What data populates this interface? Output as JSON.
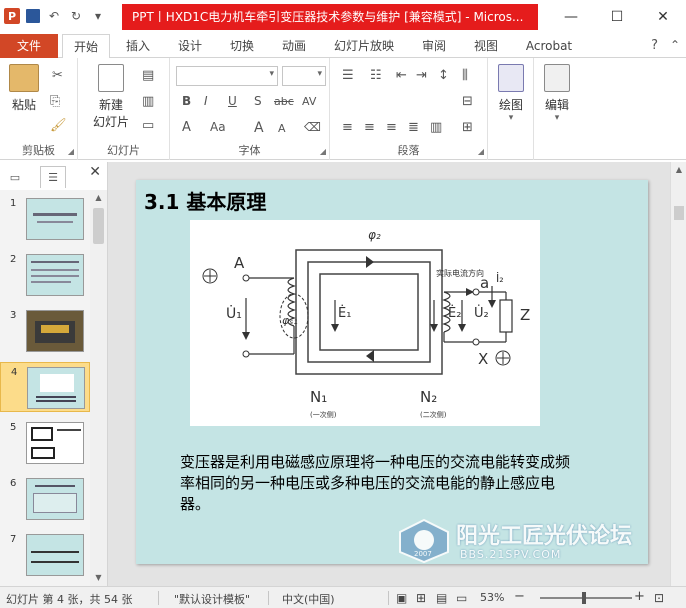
{
  "titlebar": {
    "app_glyph": "P",
    "title": "PPT丨HXD1C电力机车牵引变压器技术参数与维护 [兼容模式] - Micros...",
    "qat_undo": "↶",
    "qat_redo": "↻",
    "minimize": "—",
    "restore": "☐",
    "close": "✕"
  },
  "ribbon_tabs": {
    "file": "文件",
    "tabs": [
      "开始",
      "插入",
      "设计",
      "切换",
      "动画",
      "幻灯片放映",
      "审阅",
      "视图",
      "Acrobat"
    ],
    "help": "?",
    "collapse": "⌃"
  },
  "ribbon": {
    "clipboard": {
      "paste": "粘贴",
      "label": "剪贴板"
    },
    "slides": {
      "new_slide_line1": "新建",
      "new_slide_line2": "幻灯片",
      "label": "幻灯片"
    },
    "font": {
      "label": "字体",
      "bold": "B",
      "italic": "I",
      "underline": "U",
      "shadow": "S",
      "strike": "abc",
      "spacing": "AV",
      "grow": "A",
      "shrink": "A",
      "clear": "A"
    },
    "paragraph": {
      "label": "段落"
    },
    "drawing": {
      "label": "绘图"
    },
    "editing": {
      "label": "编辑"
    }
  },
  "slide_panel": {
    "close": "✕",
    "thumbnails": [
      {
        "num": "1"
      },
      {
        "num": "2"
      },
      {
        "num": "3"
      },
      {
        "num": "4"
      },
      {
        "num": "5"
      },
      {
        "num": "6"
      },
      {
        "num": "7"
      }
    ],
    "selected": 4
  },
  "slide": {
    "title": "3.1 基本原理",
    "body": "变压器是利用电磁感应原理将一种电压的交流电能转变成频率相同的另一种电压或多种电压的交流电能的静止感应电器。",
    "figure": {
      "phi2": "φ₂",
      "A": "A",
      "a": "a",
      "X": "X",
      "U1": "U̇₁",
      "E1": "Ė₁",
      "E2": "Ė₂",
      "U2": "U̇₂",
      "phi_s1": "φₛ₁",
      "I2": "İ₂",
      "Z": "Z",
      "N1": "N₁",
      "N2": "N₂",
      "primary": "(一次侧)",
      "secondary": "(二次侧)",
      "actual_current": "实际电流方向"
    }
  },
  "watermark": {
    "main": "阳光工匠光伏论坛",
    "sub": "BBS.21SPV.COM",
    "year": "2007"
  },
  "statusbar": {
    "slide_info": "幻灯片 第 4 张，共 54 张",
    "theme": "\"默认设计模板\"",
    "language": "中文(中国)",
    "zoom": "53%",
    "zoom_out": "−",
    "zoom_in": "+"
  }
}
